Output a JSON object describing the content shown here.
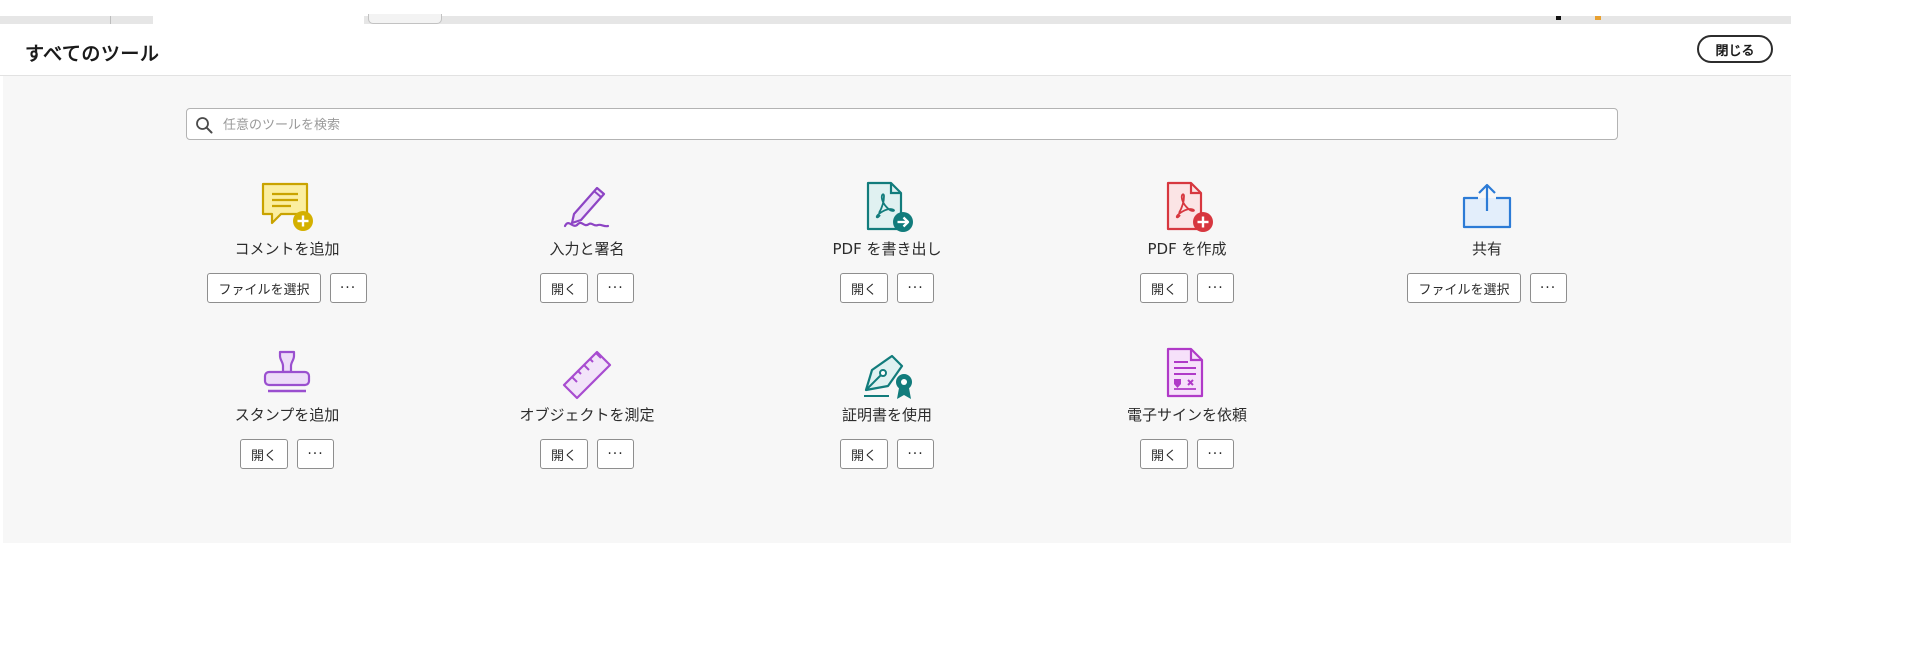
{
  "header": {
    "title": "すべてのツール",
    "close_label": "閉じる"
  },
  "search": {
    "placeholder": "任意のツールを検索",
    "value": ""
  },
  "tools": [
    {
      "id": "comment",
      "name": "コメントを追加",
      "action": "ファイルを選択",
      "more": "···",
      "icon": "comment-add-icon",
      "color": "#d6b000"
    },
    {
      "id": "fill-sign",
      "name": "入力と署名",
      "action": "開く",
      "more": "···",
      "icon": "fill-sign-icon",
      "color": "#8d44c4"
    },
    {
      "id": "export-pdf",
      "name": "PDF を書き出し",
      "action": "開く",
      "more": "···",
      "icon": "export-pdf-icon",
      "color": "#127c7c"
    },
    {
      "id": "create-pdf",
      "name": "PDF を作成",
      "action": "開く",
      "more": "···",
      "icon": "create-pdf-icon",
      "color": "#d7373f"
    },
    {
      "id": "share",
      "name": "共有",
      "action": "ファイルを選択",
      "more": "···",
      "icon": "share-icon",
      "color": "#2c7bd6"
    },
    {
      "id": "stamp",
      "name": "スタンプを追加",
      "action": "開く",
      "more": "···",
      "icon": "stamp-icon",
      "color": "#9a4fcf"
    },
    {
      "id": "measure",
      "name": "オブジェクトを測定",
      "action": "開く",
      "more": "···",
      "icon": "ruler-icon",
      "color": "#a84cd0"
    },
    {
      "id": "certificate",
      "name": "証明書を使用",
      "action": "開く",
      "more": "···",
      "icon": "certificate-pen-icon",
      "color": "#127c7c"
    },
    {
      "id": "request-esign",
      "name": "電子サインを依頼",
      "action": "開く",
      "more": "···",
      "icon": "esign-request-icon",
      "color": "#b03ac8"
    }
  ]
}
